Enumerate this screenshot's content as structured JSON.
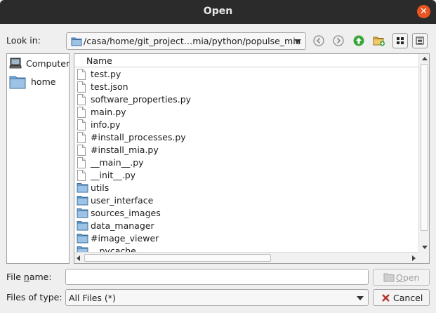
{
  "window": {
    "title": "Open",
    "close_icon": "close-icon"
  },
  "lookin": {
    "label": "Look in:",
    "path": "/casa/home/git_project…mia/python/populse_mia"
  },
  "toolbar": {
    "back_icon": "back-arrow-icon",
    "forward_icon": "forward-arrow-icon",
    "up_icon": "parent-directory-icon",
    "new_folder_icon": "new-folder-icon",
    "list_view_icon": "list-view-icon",
    "detail_view_icon": "detail-view-icon"
  },
  "sidebar": {
    "items": [
      {
        "label": "Computer",
        "icon": "computer-icon"
      },
      {
        "label": "home",
        "icon": "folder-icon"
      }
    ]
  },
  "filelist": {
    "column_header": "Name",
    "rows": [
      {
        "name": "test.py",
        "type": "file"
      },
      {
        "name": "test.json",
        "type": "file"
      },
      {
        "name": "software_properties.py",
        "type": "file"
      },
      {
        "name": "main.py",
        "type": "file"
      },
      {
        "name": "info.py",
        "type": "file"
      },
      {
        "name": "#install_processes.py",
        "type": "file"
      },
      {
        "name": "#install_mia.py",
        "type": "file"
      },
      {
        "name": "__main__.py",
        "type": "file"
      },
      {
        "name": "__init__.py",
        "type": "file"
      },
      {
        "name": "utils",
        "type": "folder"
      },
      {
        "name": "user_interface",
        "type": "folder"
      },
      {
        "name": "sources_images",
        "type": "folder"
      },
      {
        "name": "data_manager",
        "type": "folder"
      },
      {
        "name": "#image_viewer",
        "type": "folder"
      },
      {
        "name": "__pycache__",
        "type": "folder"
      }
    ]
  },
  "filename": {
    "label_pre": "File ",
    "label_mnemonic": "n",
    "label_post": "ame:",
    "value": "",
    "placeholder": ""
  },
  "filetype": {
    "label": "Files of type:",
    "value": "All Files (*)"
  },
  "buttons": {
    "open_label_mnemonic": "O",
    "open_label_rest": "pen",
    "cancel_label": "Cancel"
  },
  "colors": {
    "titlebar": "#2b2b2b",
    "close": "#e95420",
    "folder": "#6fa8dc",
    "up_arrow": "#3aa63a"
  }
}
